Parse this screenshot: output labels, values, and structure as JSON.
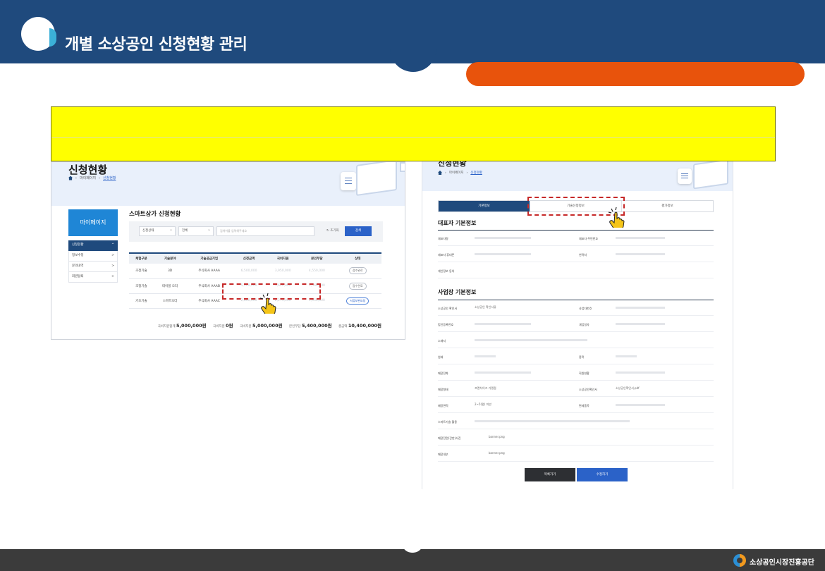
{
  "header": {
    "title": "개별 소상공인 신청현황 관리"
  },
  "footer": {
    "org_name": "소상공인시장진흥공단"
  },
  "left_screen": {
    "hero_title": "신청현황",
    "breadcrumb": [
      "마이페이지",
      "신청현황"
    ],
    "sidebar": {
      "title": "마이페이지",
      "items": [
        {
          "label": "신청현황",
          "arrow": "^"
        },
        {
          "label": "정보수정",
          "arrow": ">"
        },
        {
          "label": "문의내역",
          "arrow": ">"
        },
        {
          "label": "회원탈퇴",
          "arrow": ">"
        }
      ]
    },
    "section_title": "스마트상가 신청현황",
    "filters": {
      "status_select": "신청상태",
      "type_select": "전체",
      "search_placeholder": "검색어를 입력해주세요",
      "reset_label": "초기화",
      "search_button": "검색"
    },
    "table": {
      "headers": [
        "체험구분",
        "기술분야",
        "기술공급기업",
        "신청금액",
        "국비지원",
        "본인부담",
        "상태"
      ],
      "rows": [
        [
          "초정기술",
          "3D",
          "주식회사 AAAA",
          "6,500,000",
          "3,950,000",
          "4,550,000",
          "접수완료"
        ],
        [
          "초정기술",
          "테이블 오더",
          "주식회사 AAAB",
          "5,200,000",
          "3,640,000",
          "1,560,000",
          "접수완료"
        ],
        [
          "기초기술",
          "스마트오더",
          "주식회사 AAAC",
          "2,800,000",
          "2,275,000",
          "1,950,000",
          "서류보완요청"
        ]
      ]
    },
    "totals": {
      "total_self_label": "국비지원합계",
      "total_self_value": "5,000,000원",
      "extra_label": "국비지원",
      "extra_value": "0원",
      "gov_label": "국비지원",
      "gov_value": "5,000,000원",
      "burden_label": "본인부담",
      "burden_value": "5,400,000원",
      "sum_label": "총금액",
      "sum_value": "10,400,000원"
    }
  },
  "right_screen": {
    "hero_title": "신청현황",
    "breadcrumb": [
      "마이페이지",
      "신청현황"
    ],
    "tabs": [
      "기본정보",
      "기술신청정보",
      "평가정보"
    ],
    "rep_section": {
      "title": "대표자 기본정보",
      "rows": [
        {
          "l1": "대표자명",
          "l2": "대표자 주민번호"
        },
        {
          "l1": "대표자 휴대폰",
          "l2": "연락처"
        },
        {
          "l1": "개인정보 동의"
        }
      ]
    },
    "biz_section": {
      "title": "사업장 기본정보",
      "rows": [
        {
          "l1": "소상공인 확인서",
          "tag": "소상공인 확인서류",
          "l2": "사업자번호"
        },
        {
          "l1": "법인등록번호",
          "l2": "개업일자"
        },
        {
          "l1": "소재지"
        },
        {
          "l1": "업태",
          "l2": "종목"
        },
        {
          "l1": "매장전화",
          "l2": "직원현황"
        },
        {
          "l1": "매장형태",
          "tag": "프랜차이즈 가맹점",
          "l2": "소상공인확인서",
          "tag2": "소상공인확인서.pdf"
        },
        {
          "l1": "매장면적",
          "tag": "2~5(평) 미만",
          "l2": "면세품목"
        },
        {
          "l1": "스마트기술 활용"
        },
        {
          "l1": "매장전면(간판)사진",
          "tag": "banner.png"
        },
        {
          "l1": "매장내부",
          "tag": "banner.png"
        }
      ]
    },
    "buttons": {
      "list": "목록가기",
      "edit": "수정하기"
    }
  }
}
